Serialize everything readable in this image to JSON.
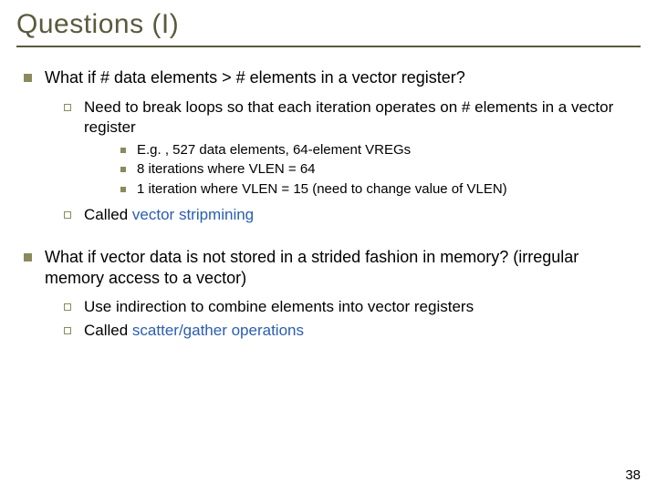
{
  "title": "Questions (I)",
  "b1": "What if # data elements > # elements in a vector register?",
  "b1_1": "Need to break loops so that each iteration operates on # elements in a vector register",
  "b1_1_1": "E.g. , 527 data elements, 64-element VREGs",
  "b1_1_2": "8 iterations where VLEN = 64",
  "b1_1_3": "1 iteration where VLEN = 15 (need to change value of VLEN)",
  "b1_2_pre": "Called ",
  "b1_2_accent": "vector stripmining",
  "b2": "What if vector data is not stored in a strided fashion in memory? (irregular memory access to a vector)",
  "b2_1": "Use indirection to combine elements into vector registers",
  "b2_2_pre": "Called ",
  "b2_2_accent": "scatter/gather operations",
  "page": "38"
}
